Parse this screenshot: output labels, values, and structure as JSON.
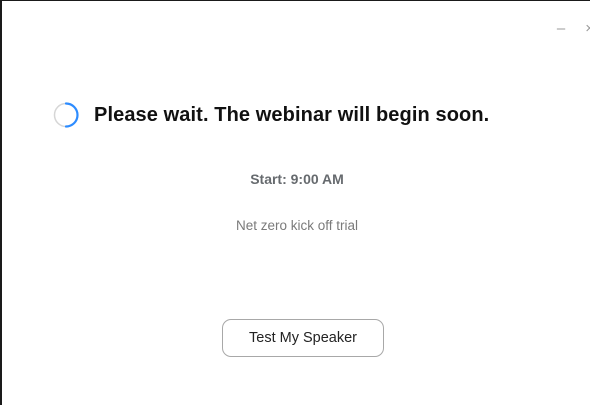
{
  "window": {
    "controls": {
      "minimize_glyph": "–",
      "close_glyph": "×"
    }
  },
  "waiting": {
    "message": "Please wait. The webinar will begin soon.",
    "start_label": "Start: 9:00 AM",
    "topic": "Net zero kick off trial",
    "spinner_icon": "loading-spinner-icon",
    "spinner_color": "#2d8cff"
  },
  "actions": {
    "test_speaker_label": "Test My Speaker"
  }
}
